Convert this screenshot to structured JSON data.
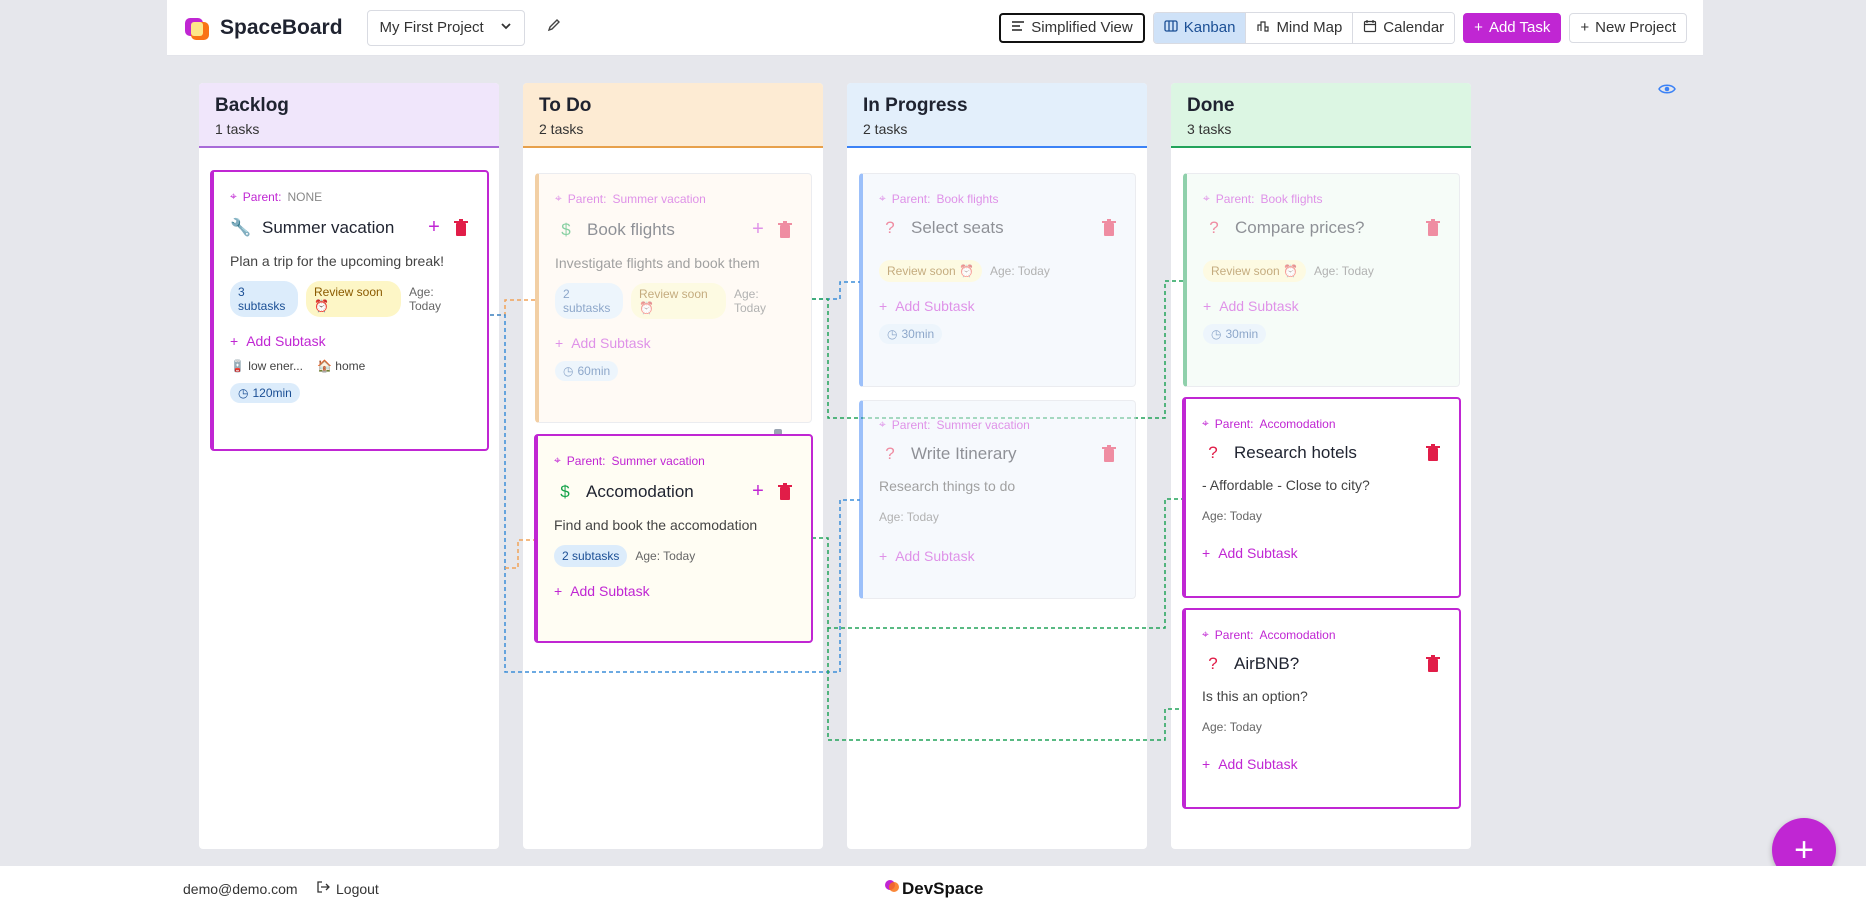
{
  "app": {
    "name": "SpaceBoard"
  },
  "header": {
    "project": "My First Project",
    "simplified_view": "Simplified View",
    "views": [
      "Kanban",
      "Mind Map",
      "Calendar"
    ],
    "active_view": "Kanban",
    "add_task": "Add Task",
    "new_project": "New Project"
  },
  "colors": {
    "accent": "#c026d3",
    "backlog": "#f0e6fb",
    "todo": "#fdebd3",
    "inprogress": "#e3effb",
    "done": "#dcf6e3"
  },
  "columns": [
    {
      "title": "Backlog",
      "count": "1 tasks"
    },
    {
      "title": "To Do",
      "count": "2 tasks"
    },
    {
      "title": "In Progress",
      "count": "2 tasks"
    },
    {
      "title": "Done",
      "count": "3 tasks"
    }
  ],
  "cards": {
    "summer": {
      "parent_label": "Parent:",
      "parent": "NONE",
      "title": "Summer vacation",
      "icon": "wrench-icon",
      "desc": "Plan a trip for the upcoming break!",
      "subtasks": "3 subtasks",
      "review": "Review soon",
      "age": "Age: Today",
      "add_subtask": "Add Subtask",
      "tag1": "low ener...",
      "tag2": "home",
      "duration": "120min"
    },
    "flights": {
      "parent_label": "Parent:",
      "parent": "Summer vacation",
      "title": "Book flights",
      "icon": "dollar-icon",
      "desc": "Investigate flights and book them",
      "subtasks": "2 subtasks",
      "review": "Review soon",
      "age": "Age: Today",
      "add_subtask": "Add Subtask",
      "duration": "60min"
    },
    "accom": {
      "parent_label": "Parent:",
      "parent": "Summer vacation",
      "title": "Accomodation",
      "icon": "dollar-icon",
      "desc": "Find and book the accomodation",
      "subtasks": "2 subtasks",
      "age": "Age: Today",
      "add_subtask": "Add Subtask"
    },
    "seats": {
      "parent_label": "Parent:",
      "parent": "Book flights",
      "title": "Select seats",
      "icon": "question-icon",
      "review": "Review soon",
      "age": "Age: Today",
      "add_subtask": "Add Subtask",
      "duration": "30min"
    },
    "itin": {
      "parent_label": "Parent:",
      "parent": "Summer vacation",
      "title": "Write Itinerary",
      "icon": "question-icon",
      "desc": "Research things to do",
      "age": "Age: Today",
      "add_subtask": "Add Subtask"
    },
    "prices": {
      "parent_label": "Parent:",
      "parent": "Book flights",
      "title": "Compare prices?",
      "icon": "question-icon",
      "review": "Review soon",
      "age": "Age: Today",
      "add_subtask": "Add Subtask",
      "duration": "30min"
    },
    "hotels": {
      "parent_label": "Parent:",
      "parent": "Accomodation",
      "title": "Research hotels",
      "icon": "question-icon",
      "desc": "- Affordable - Close to city?",
      "age": "Age: Today",
      "add_subtask": "Add Subtask"
    },
    "airbnb": {
      "parent_label": "Parent:",
      "parent": "Accomodation",
      "title": "AirBNB?",
      "icon": "question-icon",
      "desc": "Is this an option?",
      "age": "Age: Today",
      "add_subtask": "Add Subtask"
    }
  },
  "footer": {
    "email": "demo@demo.com",
    "logout": "Logout",
    "brand": "DevSpace"
  }
}
